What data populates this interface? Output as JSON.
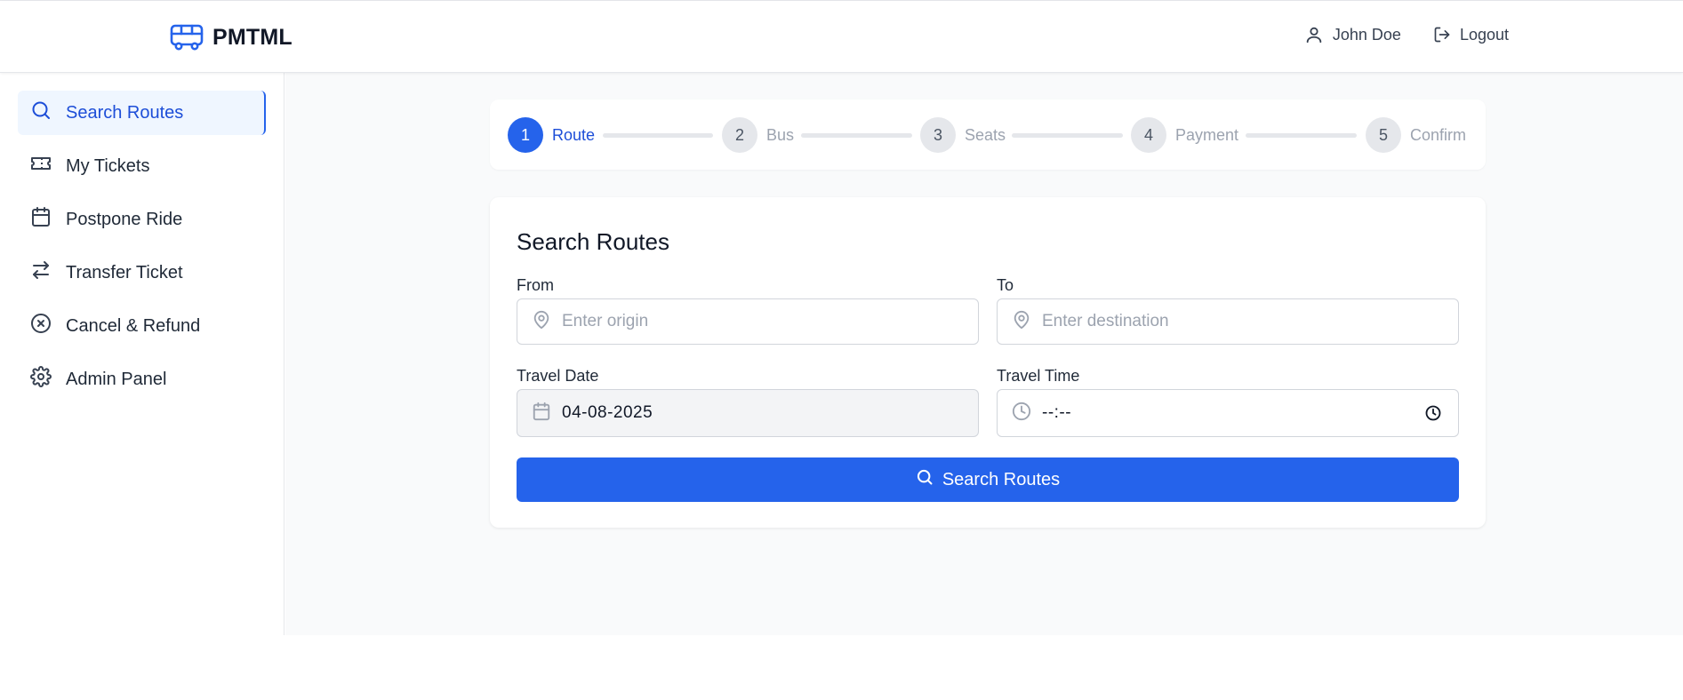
{
  "header": {
    "brand": "PMTML",
    "user_name": "John Doe",
    "logout_label": "Logout"
  },
  "sidebar": {
    "items": [
      {
        "label": "Search Routes",
        "icon": "search-icon",
        "active": true
      },
      {
        "label": "My Tickets",
        "icon": "ticket-icon",
        "active": false
      },
      {
        "label": "Postpone Ride",
        "icon": "calendar-icon",
        "active": false
      },
      {
        "label": "Transfer Ticket",
        "icon": "arrows-swap-icon",
        "active": false
      },
      {
        "label": "Cancel & Refund",
        "icon": "x-circle-icon",
        "active": false
      },
      {
        "label": "Admin Panel",
        "icon": "gear-icon",
        "active": false
      }
    ]
  },
  "stepper": {
    "steps": [
      {
        "number": "1",
        "label": "Route",
        "active": true
      },
      {
        "number": "2",
        "label": "Bus",
        "active": false
      },
      {
        "number": "3",
        "label": "Seats",
        "active": false
      },
      {
        "number": "4",
        "label": "Payment",
        "active": false
      },
      {
        "number": "5",
        "label": "Confirm",
        "active": false
      }
    ]
  },
  "form": {
    "title": "Search Routes",
    "from_label": "From",
    "from_placeholder": "Enter origin",
    "to_label": "To",
    "to_placeholder": "Enter destination",
    "date_label": "Travel Date",
    "date_value": "04-08-2025",
    "time_label": "Travel Time",
    "time_value": "--:--",
    "submit_label": "Search Routes"
  },
  "colors": {
    "primary": "#2563eb",
    "primary_text": "#1d4ed8",
    "active_bg": "#eff6ff",
    "muted": "#9ca3af",
    "background": "#f9fafb"
  }
}
